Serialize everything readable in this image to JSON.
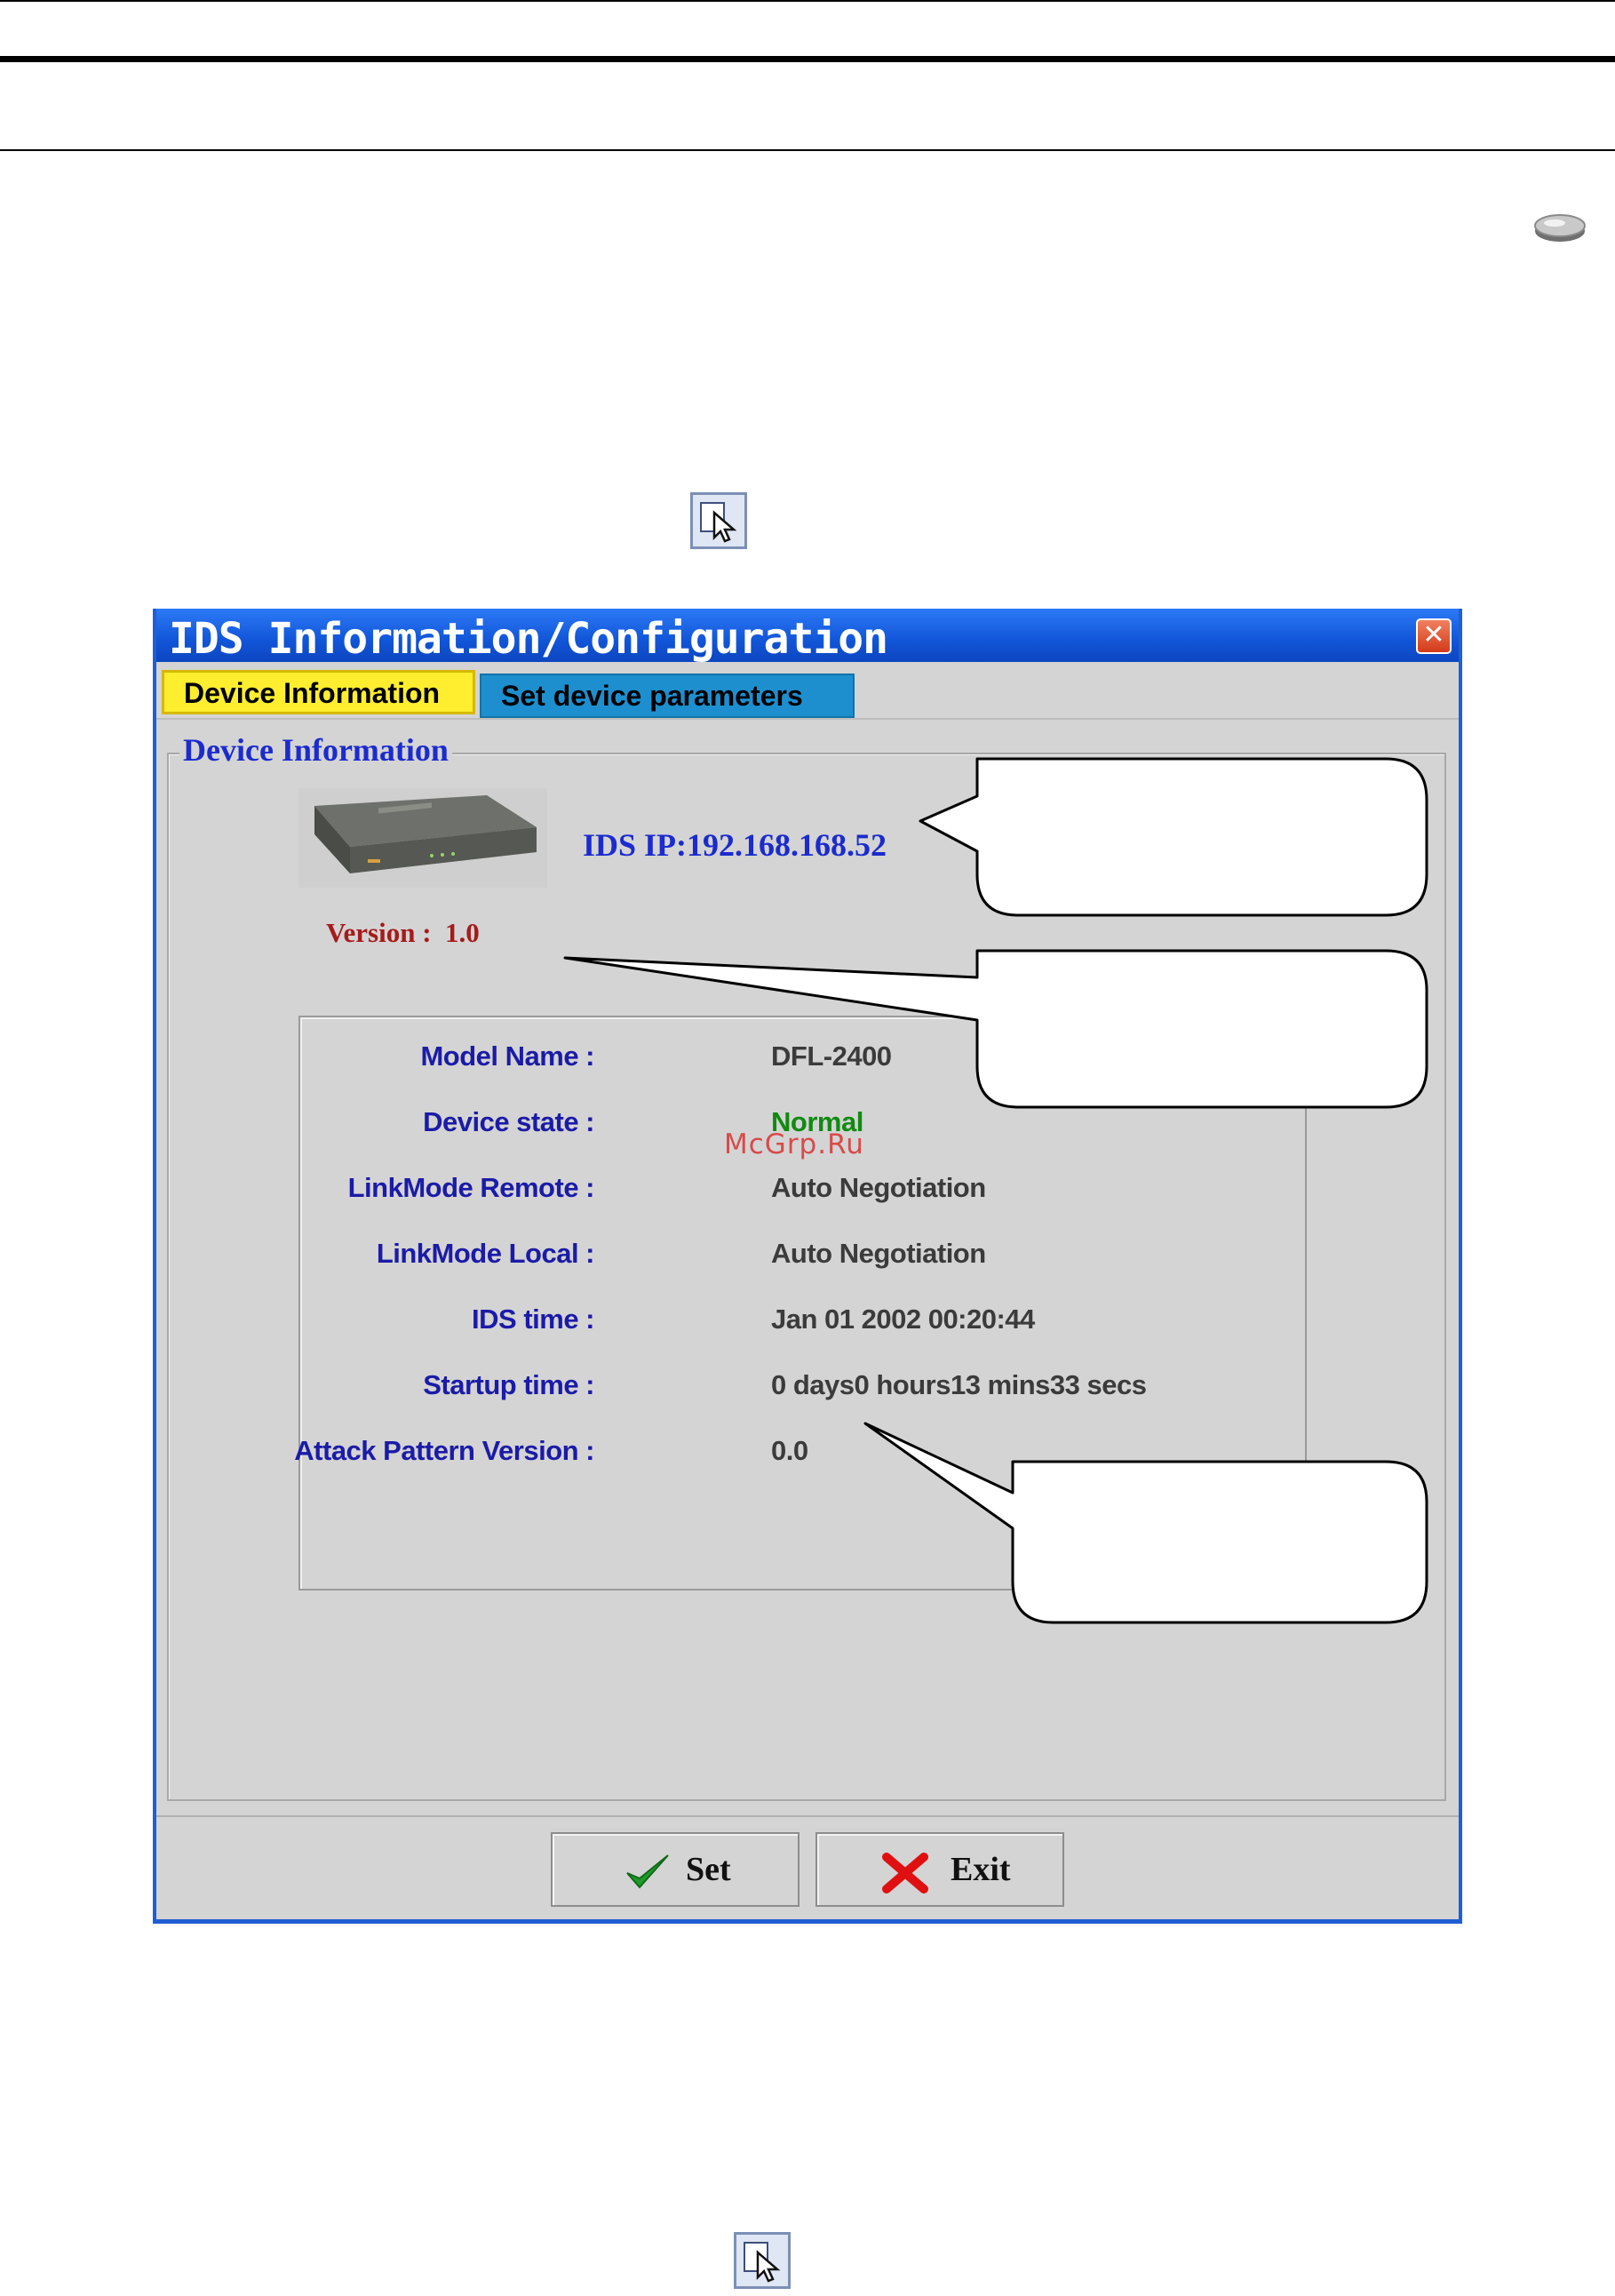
{
  "watermark": "McGrp.Ru",
  "icons": {
    "top_right": "disk-icon",
    "cursor_1": "cursor-icon",
    "cursor_2": "cursor-icon"
  },
  "dialog": {
    "title": "IDS Information/Configuration",
    "close_glyph": "✕",
    "tabs": [
      {
        "label": "Device Information",
        "active": true
      },
      {
        "label": "Set device parameters",
        "active": false
      }
    ],
    "group_title": "Device Information",
    "ids_ip": "IDS IP:192.168.168.52",
    "version": "Version :  1.0",
    "info": [
      {
        "label": "Model Name :",
        "value": "DFL-2400"
      },
      {
        "label": "Device state :",
        "value": "Normal"
      },
      {
        "label": "LinkMode Remote :",
        "value": "Auto Negotiation"
      },
      {
        "label": "LinkMode Local :",
        "value": "Auto Negotiation"
      },
      {
        "label": "IDS time :",
        "value": "Jan 01 2002 00:20:44"
      },
      {
        "label": "Startup time :",
        "value": "0 days0 hours13 mins33 secs"
      },
      {
        "label": "Attack Pattern Version :",
        "value": "0.0"
      }
    ],
    "buttons": {
      "set": "Set",
      "exit": "Exit"
    }
  },
  "colors": {
    "titlebar": "#1155d8",
    "active_tab": "#ffee30",
    "inactive_tab": "#1d8fcf",
    "label_blue": "#1b1ba8",
    "status_green": "#118a11",
    "version_red": "#a51b1b"
  }
}
